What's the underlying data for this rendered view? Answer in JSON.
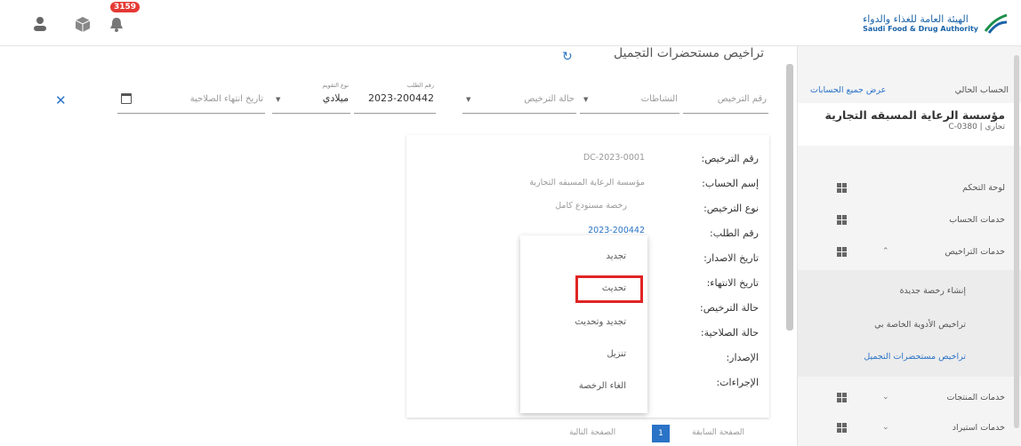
{
  "topbar": {
    "notification_count": "3159",
    "logo_ar": "الهيئة العامة للغذاء والدواء",
    "logo_en": "Saudi Food & Drug Authority"
  },
  "sidebar": {
    "current_account_label": "الحساب الحالي",
    "show_all_accounts": "عرض جميع الحسابات",
    "account_name": "مؤسسة الرعاية المسبقه التجارية",
    "account_sub": "تجاري | C-0380",
    "items": [
      {
        "label": "لوحة التحكم",
        "expandable": false
      },
      {
        "label": "خدمات الحساب",
        "expandable": false
      },
      {
        "label": "خدمات التراخيص",
        "expandable": true
      },
      {
        "label": "خدمات المنتجات",
        "expandable": true
      },
      {
        "label": "خدمات استيراد",
        "expandable": true
      }
    ],
    "subitems": [
      {
        "label": "إنشاء رخصة جديدة"
      },
      {
        "label": "تراخيص الأدوية الخاصة بي"
      },
      {
        "label": "تراخيص مستحضرات التجميل"
      }
    ]
  },
  "main": {
    "title": "تراخيص مستحضرات التجميل",
    "filters": {
      "license_no_placeholder": "رقم الترخيص",
      "activities_placeholder": "النشاطات",
      "status_placeholder": "حالة الترخيص",
      "request_no_label": "رقم الطلب",
      "request_no_value": "2023-200442",
      "calendar_label": "نوع التقويم",
      "calendar_value": "ميلادي",
      "expiry_placeholder": "تاريخ انتهاء الصلاحية"
    },
    "details": {
      "rows": [
        {
          "label": "رقم الترخيص:",
          "value": "DC-2023-0001"
        },
        {
          "label": "إسم الحساب:",
          "value": "مؤسسة الرعاية المسبقه التجارية"
        },
        {
          "label": "نوع الترخيص:",
          "value": "رخصة مستودع كامل"
        },
        {
          "label": "رقم الطلب:",
          "value": "2023-200442"
        },
        {
          "label": "تاريخ الاصدار:",
          "value": ""
        },
        {
          "label": "تاريخ الانتهاء:",
          "value": ""
        },
        {
          "label": "حالة الترخيص:",
          "value": ""
        },
        {
          "label": "حالة الصلاحية:",
          "value": ""
        },
        {
          "label": "الإصدار:",
          "value": ""
        },
        {
          "label": "الإجراءات:",
          "value": ""
        }
      ]
    },
    "actions_menu": {
      "items": [
        {
          "label": "تجديد"
        },
        {
          "label": "تحديث"
        },
        {
          "label": "تجديد وتحديث"
        },
        {
          "label": "تنزيل"
        },
        {
          "label": "الغاء الرخصة"
        }
      ]
    },
    "pagination": {
      "prev": "الصفحة السابقة",
      "page": "1",
      "next": "الصفحة التالية"
    }
  },
  "colors": {
    "accent": "#2a73c6",
    "highlight": "#e02424",
    "badge": "#e53935"
  }
}
